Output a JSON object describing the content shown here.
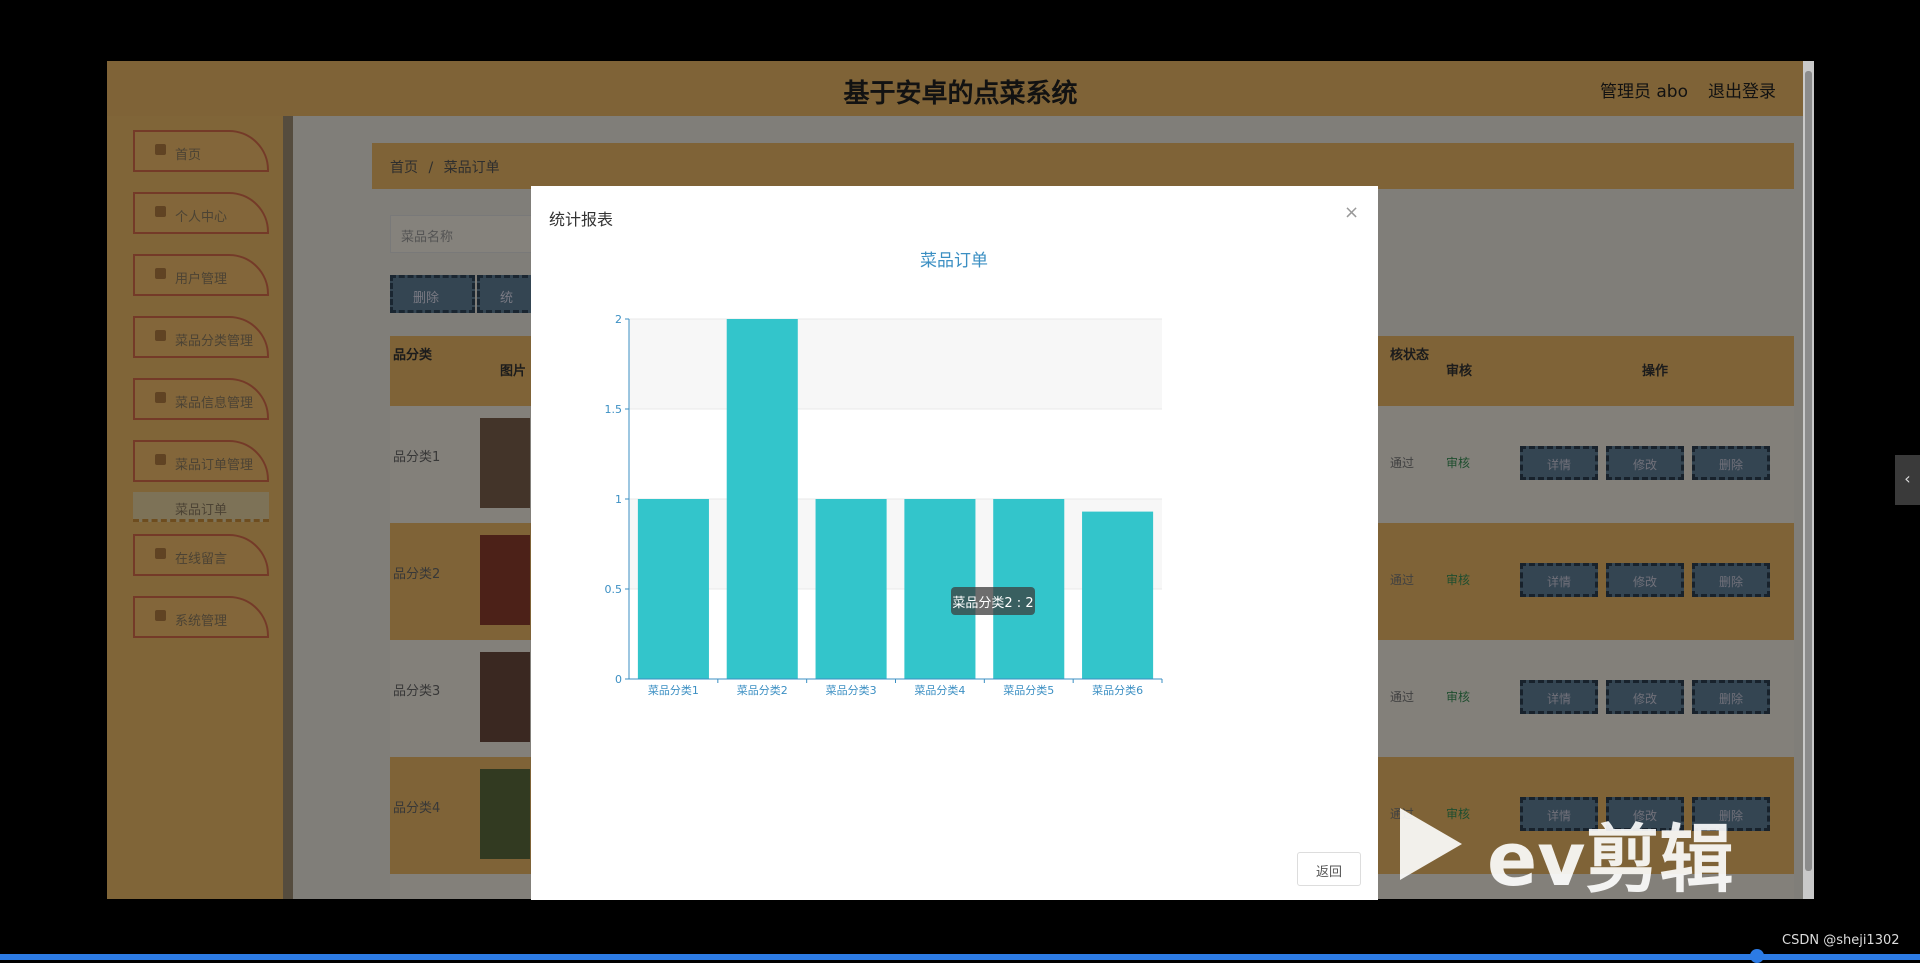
{
  "app": {
    "title": "基于安卓的点菜系统",
    "admin_label": "管理员 abo",
    "logout_label": "退出登录"
  },
  "sidebar": {
    "items": [
      {
        "label": "首页",
        "icon": "home-icon"
      },
      {
        "label": "个人中心",
        "icon": "user-icon"
      },
      {
        "label": "用户管理",
        "icon": "grid-icon"
      },
      {
        "label": "菜品分类管理",
        "icon": "bag-icon"
      },
      {
        "label": "菜品信息管理",
        "icon": "grid-icon"
      },
      {
        "label": "菜品订单管理",
        "icon": "user-icon"
      },
      {
        "label": "在线留言",
        "icon": "doc-icon"
      },
      {
        "label": "系统管理",
        "icon": "grid-icon"
      }
    ],
    "active_sub": "菜品订单"
  },
  "breadcrumb": {
    "home": "首页",
    "separator": "/",
    "current": "菜品订单"
  },
  "search": {
    "placeholder": "菜品名称"
  },
  "toolbar": {
    "delete_label": "删除",
    "stats_label": "统"
  },
  "table": {
    "headers": {
      "category": "品分类",
      "image": "图片",
      "audit_status": "核状态",
      "audit": "审核",
      "actions": "操作"
    },
    "rows": [
      {
        "category": "品分类1",
        "status": "通过",
        "audit": "审核",
        "actions": [
          "详情",
          "修改",
          "删除"
        ]
      },
      {
        "category": "品分类2",
        "status": "通过",
        "audit": "审核",
        "actions": [
          "详情",
          "修改",
          "删除"
        ]
      },
      {
        "category": "品分类3",
        "status": "通过",
        "audit": "审核",
        "actions": [
          "详情",
          "修改",
          "删除"
        ]
      },
      {
        "category": "品分类4",
        "status": "通过",
        "audit": "审核",
        "actions": [
          "详情",
          "修改",
          "删除"
        ]
      }
    ]
  },
  "modal": {
    "title": "统计报表",
    "close_symbol": "×",
    "return_label": "返回",
    "tooltip": "菜品分类2 : 2"
  },
  "chart_data": {
    "type": "bar",
    "title": "菜品订单",
    "categories": [
      "菜品分类1",
      "菜品分类2",
      "菜品分类3",
      "菜品分类4",
      "菜品分类5",
      "菜品分类6"
    ],
    "values": [
      1,
      2,
      1,
      1,
      1,
      0.93
    ],
    "ylim": [
      0,
      2
    ],
    "yticks": [
      "0",
      "0.5",
      "1",
      "1.5",
      "2"
    ],
    "bar_color": "#33c5cb",
    "grid": true,
    "xlabel": "",
    "ylabel": ""
  },
  "overlay": {
    "watermark": "ev剪辑",
    "credit": "CSDN @sheji1302"
  },
  "colors": {
    "accent": "#e7b564",
    "bar": "#33c5cb",
    "title_blue": "#3b8fc3"
  }
}
